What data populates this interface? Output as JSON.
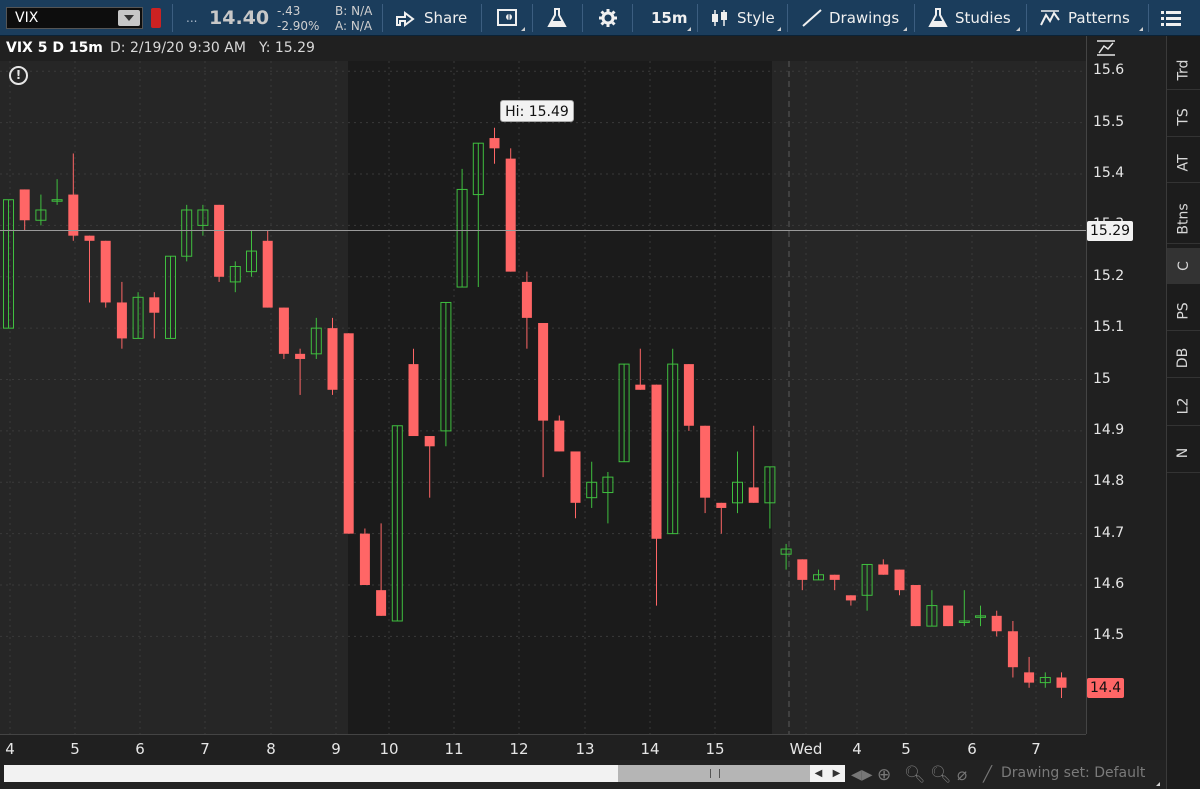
{
  "toolbar": {
    "symbol": "VIX",
    "ellipsis": "...",
    "last_price": "14.40",
    "net_change": "-.43",
    "pct_change": "-2.90%",
    "bid": "B: N/A",
    "ask": "A: N/A",
    "share_label": "Share",
    "timeframe": "15m",
    "style_label": "Style",
    "drawings_label": "Drawings",
    "studies_label": "Studies",
    "patterns_label": "Patterns"
  },
  "header": {
    "chart_title": "VIX 5 D 15m",
    "date_readout": "D: 2/19/20 9:30 AM",
    "y_readout": "Y: 15.29"
  },
  "chart_data": {
    "type": "candlestick",
    "ylim": [
      14.31,
      15.62
    ],
    "y_ticks": [
      "15.6",
      "15.5",
      "15.4",
      "15.3",
      "15.2",
      "15.1",
      "15",
      "14.9",
      "14.8",
      "14.7",
      "14.6",
      "14.5"
    ],
    "x_ticks": [
      "4",
      "5",
      "6",
      "7",
      "8",
      "9",
      "10",
      "11",
      "12",
      "13",
      "14",
      "15",
      "Wed",
      "4",
      "5",
      "6",
      "7"
    ],
    "high_label": "Hi: 15.49",
    "crosshair_label": "15.29",
    "crosshair_value": 15.29,
    "last_label": "14.4",
    "last_value": 14.4,
    "colors": {
      "up": "#3fbf3f",
      "down": "#ff6666"
    },
    "candles": [
      {
        "o": 15.1,
        "h": 15.35,
        "l": 15.1,
        "c": 15.35
      },
      {
        "o": 15.37,
        "h": 15.37,
        "l": 15.29,
        "c": 15.31
      },
      {
        "o": 15.31,
        "h": 15.36,
        "l": 15.3,
        "c": 15.33
      },
      {
        "o": 15.35,
        "h": 15.39,
        "l": 15.34,
        "c": 15.35
      },
      {
        "o": 15.36,
        "h": 15.44,
        "l": 15.27,
        "c": 15.28
      },
      {
        "o": 15.28,
        "h": 15.28,
        "l": 15.15,
        "c": 15.27
      },
      {
        "o": 15.27,
        "h": 15.27,
        "l": 15.14,
        "c": 15.15
      },
      {
        "o": 15.15,
        "h": 15.19,
        "l": 15.06,
        "c": 15.08
      },
      {
        "o": 15.08,
        "h": 15.17,
        "l": 15.08,
        "c": 15.16
      },
      {
        "o": 15.16,
        "h": 15.17,
        "l": 15.08,
        "c": 15.13
      },
      {
        "o": 15.08,
        "h": 15.24,
        "l": 15.08,
        "c": 15.24
      },
      {
        "o": 15.24,
        "h": 15.34,
        "l": 15.23,
        "c": 15.33
      },
      {
        "o": 15.3,
        "h": 15.34,
        "l": 15.28,
        "c": 15.33
      },
      {
        "o": 15.34,
        "h": 15.34,
        "l": 15.19,
        "c": 15.2
      },
      {
        "o": 15.19,
        "h": 15.23,
        "l": 15.17,
        "c": 15.22
      },
      {
        "o": 15.21,
        "h": 15.29,
        "l": 15.2,
        "c": 15.25
      },
      {
        "o": 15.27,
        "h": 15.29,
        "l": 15.14,
        "c": 15.14
      },
      {
        "o": 15.14,
        "h": 15.14,
        "l": 15.04,
        "c": 15.05
      },
      {
        "o": 15.05,
        "h": 15.06,
        "l": 14.97,
        "c": 15.04
      },
      {
        "o": 15.05,
        "h": 15.12,
        "l": 15.04,
        "c": 15.1
      },
      {
        "o": 15.1,
        "h": 15.12,
        "l": 14.97,
        "c": 14.98
      },
      {
        "o": 15.09,
        "h": 15.09,
        "l": 14.7,
        "c": 14.7
      },
      {
        "o": 14.7,
        "h": 14.71,
        "l": 14.6,
        "c": 14.6
      },
      {
        "o": 14.59,
        "h": 14.72,
        "l": 14.54,
        "c": 14.54
      },
      {
        "o": 14.53,
        "h": 14.91,
        "l": 14.53,
        "c": 14.91
      },
      {
        "o": 15.03,
        "h": 15.06,
        "l": 14.89,
        "c": 14.89
      },
      {
        "o": 14.89,
        "h": 14.89,
        "l": 14.77,
        "c": 14.87
      },
      {
        "o": 14.9,
        "h": 15.15,
        "l": 14.87,
        "c": 15.15
      },
      {
        "o": 15.18,
        "h": 15.41,
        "l": 15.18,
        "c": 15.37
      },
      {
        "o": 15.36,
        "h": 15.46,
        "l": 15.18,
        "c": 15.46
      },
      {
        "o": 15.47,
        "h": 15.49,
        "l": 15.42,
        "c": 15.45
      },
      {
        "o": 15.43,
        "h": 15.45,
        "l": 15.21,
        "c": 15.21
      },
      {
        "o": 15.19,
        "h": 15.21,
        "l": 15.06,
        "c": 15.12
      },
      {
        "o": 15.11,
        "h": 15.11,
        "l": 14.81,
        "c": 14.92
      },
      {
        "o": 14.92,
        "h": 14.93,
        "l": 14.86,
        "c": 14.86
      },
      {
        "o": 14.86,
        "h": 14.86,
        "l": 14.73,
        "c": 14.76
      },
      {
        "o": 14.77,
        "h": 14.84,
        "l": 14.75,
        "c": 14.8
      },
      {
        "o": 14.78,
        "h": 14.82,
        "l": 14.72,
        "c": 14.81
      },
      {
        "o": 14.84,
        "h": 15.03,
        "l": 14.84,
        "c": 15.03
      },
      {
        "o": 14.99,
        "h": 15.06,
        "l": 14.98,
        "c": 14.98
      },
      {
        "o": 14.99,
        "h": 14.99,
        "l": 14.56,
        "c": 14.69
      },
      {
        "o": 14.7,
        "h": 15.06,
        "l": 14.7,
        "c": 15.03
      },
      {
        "o": 15.03,
        "h": 15.03,
        "l": 14.9,
        "c": 14.91
      },
      {
        "o": 14.91,
        "h": 14.91,
        "l": 14.74,
        "c": 14.77
      },
      {
        "o": 14.76,
        "h": 14.76,
        "l": 14.7,
        "c": 14.75
      },
      {
        "o": 14.76,
        "h": 14.86,
        "l": 14.74,
        "c": 14.8
      },
      {
        "o": 14.79,
        "h": 14.91,
        "l": 14.76,
        "c": 14.76
      },
      {
        "o": 14.76,
        "h": 14.83,
        "l": 14.71,
        "c": 14.83
      },
      {
        "o": 14.66,
        "h": 14.68,
        "l": 14.63,
        "c": 14.67
      },
      {
        "o": 14.65,
        "h": 14.65,
        "l": 14.59,
        "c": 14.61
      },
      {
        "o": 14.61,
        "h": 14.63,
        "l": 14.61,
        "c": 14.62
      },
      {
        "o": 14.62,
        "h": 14.62,
        "l": 14.59,
        "c": 14.61
      },
      {
        "o": 14.58,
        "h": 14.58,
        "l": 14.56,
        "c": 14.57
      },
      {
        "o": 14.58,
        "h": 14.64,
        "l": 14.55,
        "c": 14.64
      },
      {
        "o": 14.64,
        "h": 14.65,
        "l": 14.62,
        "c": 14.62
      },
      {
        "o": 14.63,
        "h": 14.63,
        "l": 14.58,
        "c": 14.59
      },
      {
        "o": 14.6,
        "h": 14.6,
        "l": 14.52,
        "c": 14.52
      },
      {
        "o": 14.52,
        "h": 14.59,
        "l": 14.52,
        "c": 14.56
      },
      {
        "o": 14.56,
        "h": 14.56,
        "l": 14.52,
        "c": 14.52
      },
      {
        "o": 14.53,
        "h": 14.59,
        "l": 14.52,
        "c": 14.53
      },
      {
        "o": 14.54,
        "h": 14.56,
        "l": 14.52,
        "c": 14.54
      },
      {
        "o": 14.54,
        "h": 14.55,
        "l": 14.5,
        "c": 14.51
      },
      {
        "o": 14.51,
        "h": 14.53,
        "l": 14.42,
        "c": 14.44
      },
      {
        "o": 14.43,
        "h": 14.46,
        "l": 14.4,
        "c": 14.41
      },
      {
        "o": 14.41,
        "h": 14.43,
        "l": 14.4,
        "c": 14.42
      },
      {
        "o": 14.42,
        "h": 14.43,
        "l": 14.38,
        "c": 14.4
      }
    ]
  },
  "right_tabs": [
    "Trd",
    "TS",
    "AT",
    "Btns",
    "C",
    "PS",
    "DB",
    "L2",
    "N"
  ],
  "bottom": {
    "drawing_set": "Drawing set: Default"
  }
}
